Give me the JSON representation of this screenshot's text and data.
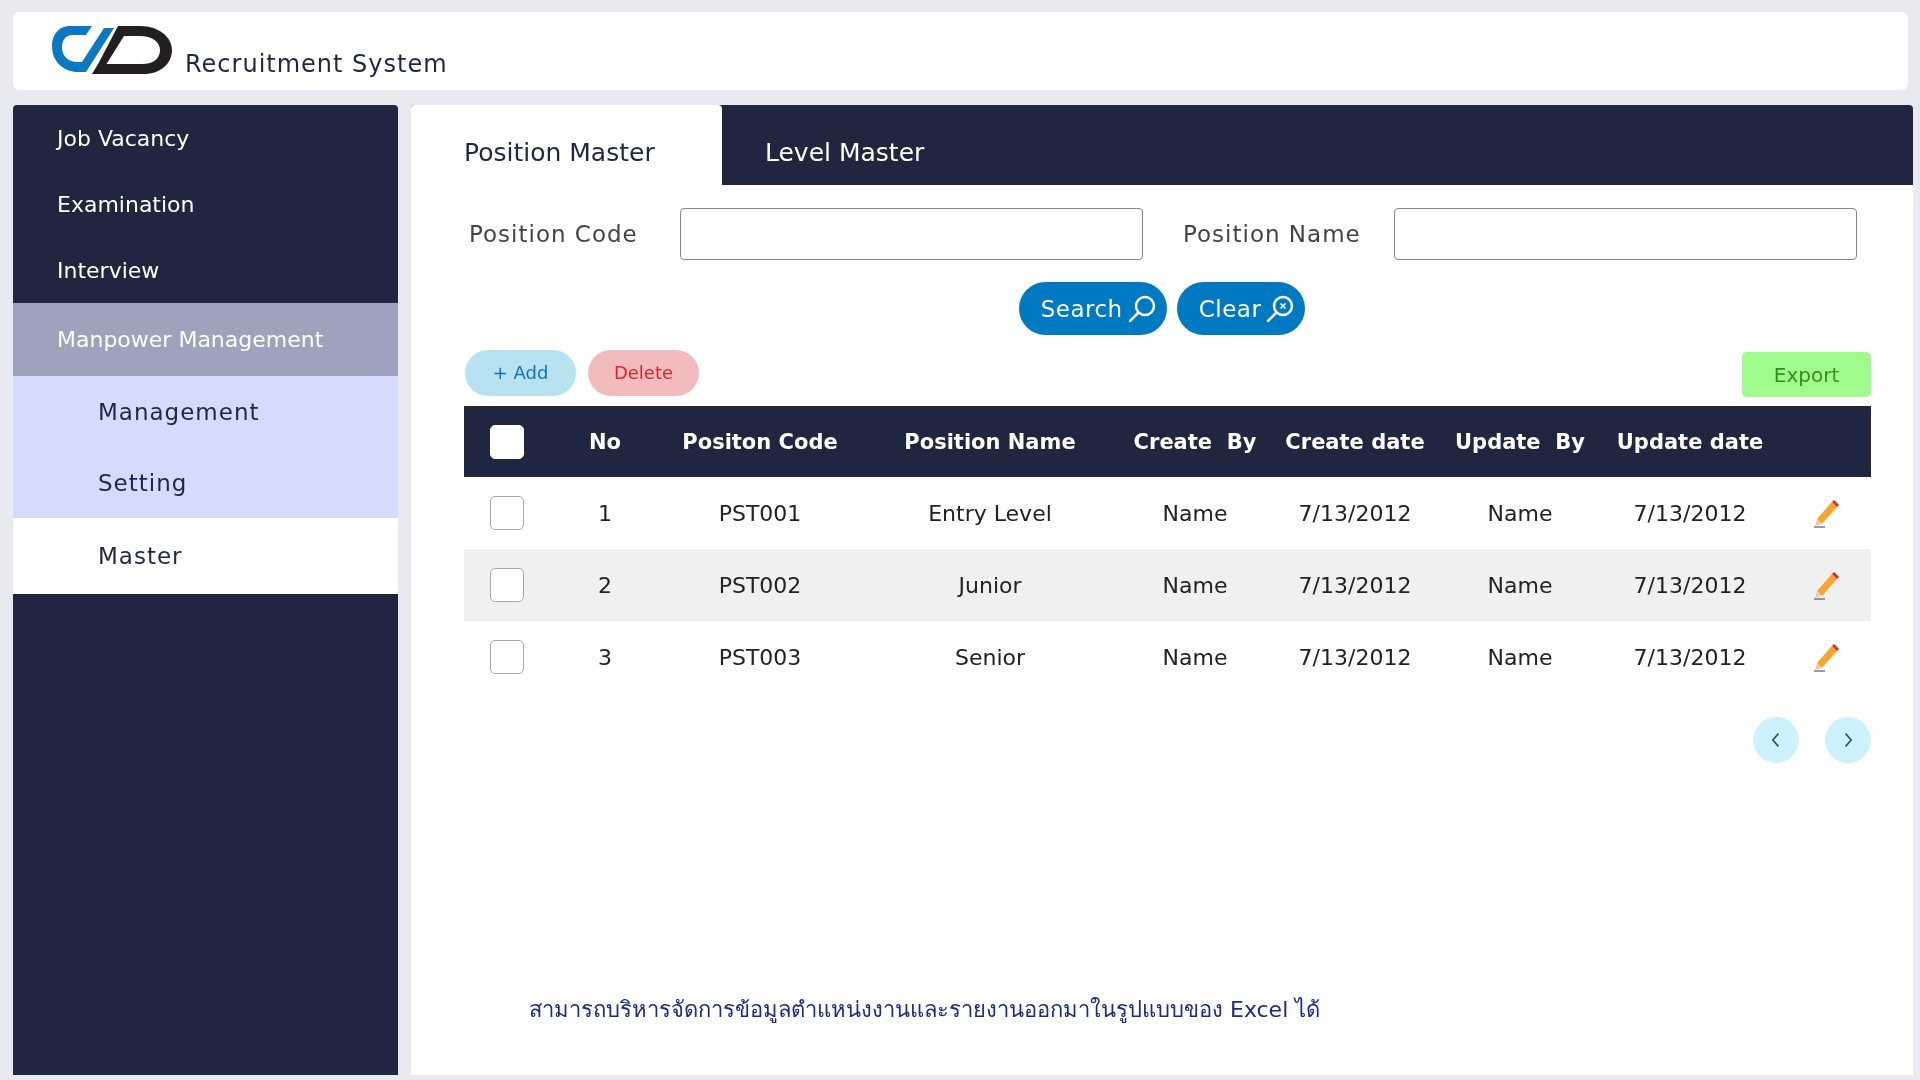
{
  "header": {
    "title": "Recruitment System"
  },
  "sidebar": {
    "items": [
      {
        "label": "Job Vacancy",
        "selected": false
      },
      {
        "label": "Examination",
        "selected": false
      },
      {
        "label": "Interview",
        "selected": false
      },
      {
        "label": "Manpower Management",
        "selected": false,
        "expanded": true,
        "children": [
          {
            "label": "Management",
            "selected": false
          },
          {
            "label": "Setting",
            "selected": false
          },
          {
            "label": "Master",
            "selected": true
          }
        ]
      }
    ]
  },
  "tabs": [
    {
      "label": "Position Master",
      "selected": true
    },
    {
      "label": "Level Master",
      "selected": false
    }
  ],
  "filters": [
    {
      "label": "Position Code"
    },
    {
      "label": "Position Name"
    }
  ],
  "search_buttons": [
    "Search",
    "Clear"
  ],
  "actions": {
    "add": "+ Add",
    "delete": "Delete",
    "export": "Export"
  },
  "table": {
    "header_checked": false,
    "columns": [
      "No",
      "Positon Code",
      "Position Name",
      "Create  By",
      "Create date",
      "Update  By",
      "Update date"
    ],
    "rows": [
      {
        "checked": false,
        "cells": [
          "1",
          "PST001",
          "Entry Level",
          "Name",
          "7/13/2012",
          "Name",
          "7/13/2012"
        ]
      },
      {
        "checked": false,
        "cells": [
          "2",
          "PST002",
          "Junior",
          "Name",
          "7/13/2012",
          "Name",
          "7/13/2012"
        ]
      },
      {
        "checked": false,
        "cells": [
          "3",
          "PST003",
          "Senior",
          "Name",
          "7/13/2012",
          "Name",
          "7/13/2012"
        ]
      }
    ]
  },
  "note": "สามารถบริหารจัดการข้อมูลตำแหน่งงานและรายงานออกมาในรูปแบบของ Excel ได้"
}
